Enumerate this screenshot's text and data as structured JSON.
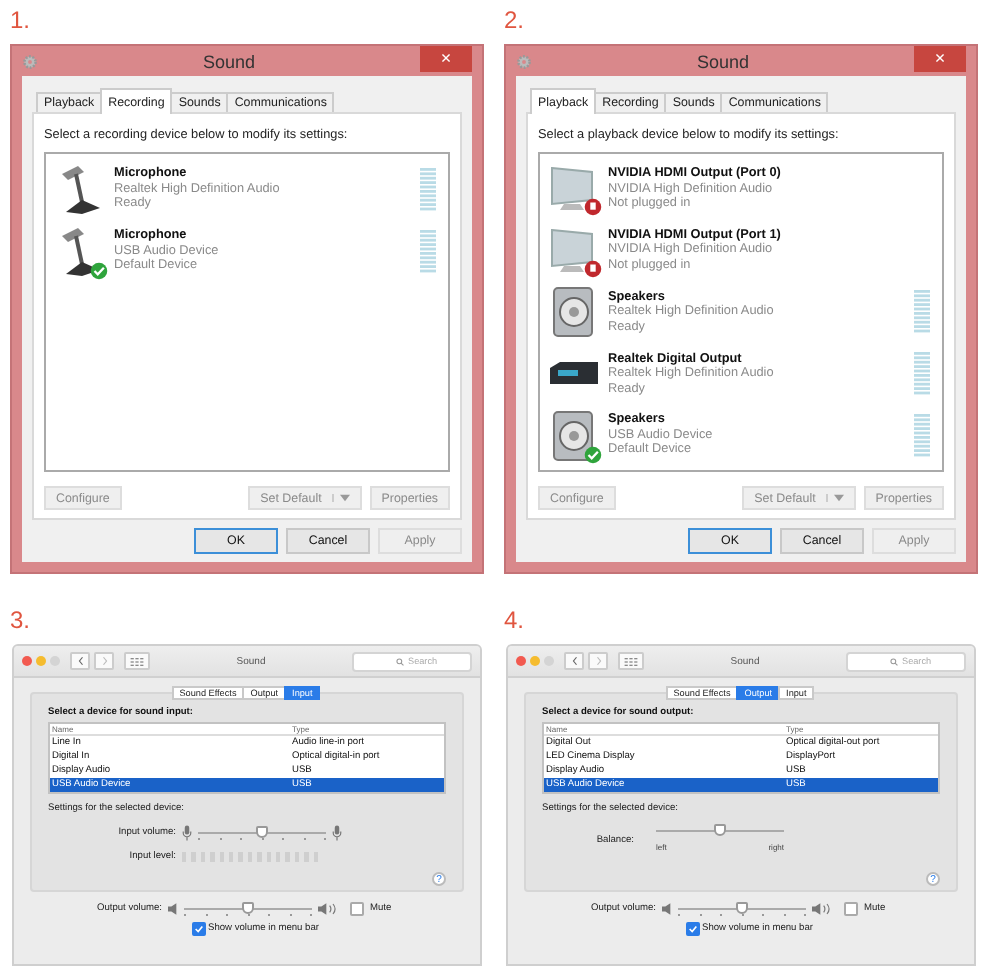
{
  "panels": [
    {
      "number": "1.",
      "kind": "windows",
      "title": "Sound",
      "close": "×",
      "tabs": [
        {
          "label": "Playback",
          "selected": false
        },
        {
          "label": "Recording",
          "selected": true
        },
        {
          "label": "Sounds",
          "selected": false
        },
        {
          "label": "Communications",
          "selected": false
        }
      ],
      "instruction": "Select a recording device below to modify its settings:",
      "devices": [
        {
          "kind": "microphone",
          "name": "Microphone",
          "driver": "Realtek High Definition Audio",
          "status": "Ready",
          "default": false,
          "unplugged": false
        },
        {
          "kind": "microphone",
          "name": "Microphone",
          "driver": "USB Audio Device",
          "status": "Default Device",
          "default": true,
          "unplugged": false
        }
      ],
      "device_buttons": [
        {
          "kind": "plain",
          "label": "Configure",
          "disabled": true
        },
        {
          "kind": "split",
          "label": "Set Default",
          "disabled": true
        },
        {
          "kind": "plain",
          "label": "Properties",
          "disabled": true
        }
      ],
      "dialog_buttons": [
        {
          "label": "OK",
          "disabled": false,
          "default": true
        },
        {
          "label": "Cancel",
          "disabled": false,
          "default": false
        },
        {
          "label": "Apply",
          "disabled": true,
          "default": false
        }
      ]
    },
    {
      "number": "2.",
      "kind": "windows",
      "title": "Sound",
      "close": "×",
      "tabs": [
        {
          "label": "Playback",
          "selected": true
        },
        {
          "label": "Recording",
          "selected": false
        },
        {
          "label": "Sounds",
          "selected": false
        },
        {
          "label": "Communications",
          "selected": false
        }
      ],
      "instruction": "Select a playback device below to modify its settings:",
      "devices": [
        {
          "kind": "monitor",
          "name": "NVIDIA HDMI Output (Port 0)",
          "driver": "NVIDIA High Definition Audio",
          "status": "Not plugged in",
          "default": false,
          "unplugged": true
        },
        {
          "kind": "monitor",
          "name": "NVIDIA HDMI Output (Port 1)",
          "driver": "NVIDIA High Definition Audio",
          "status": "Not plugged in",
          "default": false,
          "unplugged": true
        },
        {
          "kind": "speaker",
          "name": "Speakers",
          "driver": "Realtek High Definition Audio",
          "status": "Ready",
          "default": false,
          "unplugged": false
        },
        {
          "kind": "receiver",
          "name": "Realtek Digital Output",
          "driver": "Realtek High Definition Audio",
          "status": "Ready",
          "default": false,
          "unplugged": false
        },
        {
          "kind": "speaker",
          "name": "Speakers",
          "driver": "USB Audio Device",
          "status": "Default Device",
          "default": true,
          "unplugged": false
        }
      ],
      "device_buttons": [
        {
          "kind": "plain",
          "label": "Configure",
          "disabled": true
        },
        {
          "kind": "split",
          "label": "Set Default",
          "disabled": true
        },
        {
          "kind": "plain",
          "label": "Properties",
          "disabled": true
        }
      ],
      "dialog_buttons": [
        {
          "label": "OK",
          "disabled": false,
          "default": true
        },
        {
          "label": "Cancel",
          "disabled": false,
          "default": false
        },
        {
          "label": "Apply",
          "disabled": true,
          "default": false
        }
      ]
    },
    {
      "number": "3.",
      "kind": "mac",
      "title": "Sound",
      "search_placeholder": "Search",
      "tabs": [
        {
          "label": "Sound Effects",
          "selected": false
        },
        {
          "label": "Output",
          "selected": false
        },
        {
          "label": "Input",
          "selected": true
        }
      ],
      "heading": "Select a device for sound input:",
      "columns": [
        "Name",
        "Type"
      ],
      "rows": [
        {
          "cells": [
            "Line In",
            "Audio line-in port"
          ],
          "selected": false
        },
        {
          "cells": [
            "Digital In",
            "Optical digital-in port"
          ],
          "selected": false
        },
        {
          "cells": [
            "Display Audio",
            "USB"
          ],
          "selected": false
        },
        {
          "cells": [
            "USB Audio Device",
            "USB"
          ],
          "selected": true
        }
      ],
      "settings_label": "Settings for the selected device:",
      "controls": [
        {
          "kind": "input_volume",
          "label": "Input volume:",
          "level": 0.5
        },
        {
          "kind": "input_level",
          "label": "Input level:",
          "level": 0
        }
      ],
      "help": "?",
      "output_volume": {
        "label": "Output volume:",
        "level": 0.5
      },
      "mute": {
        "label": "Mute",
        "checked": false
      },
      "menu_bar": {
        "label": "Show volume in menu bar",
        "checked": true
      }
    },
    {
      "number": "4.",
      "kind": "mac",
      "title": "Sound",
      "search_placeholder": "Search",
      "tabs": [
        {
          "label": "Sound Effects",
          "selected": false
        },
        {
          "label": "Output",
          "selected": true
        },
        {
          "label": "Input",
          "selected": false
        }
      ],
      "heading": "Select a device for sound output:",
      "columns": [
        "Name",
        "Type"
      ],
      "rows": [
        {
          "cells": [
            "Digital Out",
            "Optical digital-out port"
          ],
          "selected": false
        },
        {
          "cells": [
            "LED Cinema Display",
            "DisplayPort"
          ],
          "selected": false
        },
        {
          "cells": [
            "Display Audio",
            "USB"
          ],
          "selected": false
        },
        {
          "cells": [
            "USB Audio Device",
            "USB"
          ],
          "selected": true
        }
      ],
      "settings_label": "Settings for the selected device:",
      "controls": [
        {
          "kind": "balance",
          "label": "Balance:",
          "level": 0.5,
          "left_label": "left",
          "right_label": "right"
        }
      ],
      "help": "?",
      "output_volume": {
        "label": "Output volume:",
        "level": 0.5
      },
      "mute": {
        "label": "Mute",
        "checked": false
      },
      "menu_bar": {
        "label": "Show volume in menu bar",
        "checked": true
      }
    }
  ]
}
